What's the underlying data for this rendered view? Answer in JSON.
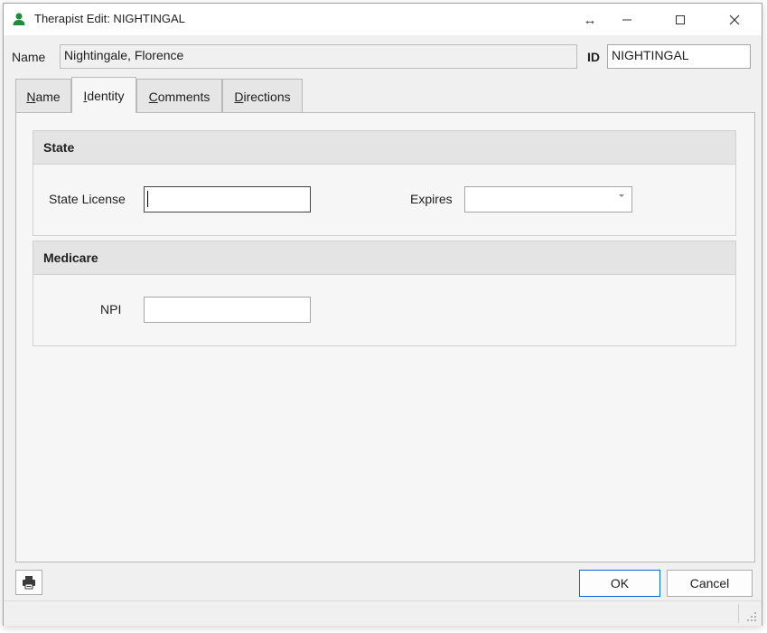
{
  "window": {
    "title": "Therapist Edit: NIGHTINGAL",
    "controls": {
      "resize": "↔",
      "minimize": "—",
      "maximize": "☐",
      "close": "✕"
    }
  },
  "header": {
    "name_label": "Name",
    "name_value": "Nightingale, Florence",
    "id_label": "ID",
    "id_value": "NIGHTINGAL"
  },
  "tabs": [
    {
      "accel": "N",
      "rest": "ame"
    },
    {
      "accel": "I",
      "rest": "dentity"
    },
    {
      "accel": "C",
      "rest": "omments"
    },
    {
      "accel": "D",
      "rest": "irections"
    }
  ],
  "active_tab": "Identity",
  "state_group": {
    "title": "State",
    "license_label": "State License",
    "license_value": "",
    "expires_label": "Expires",
    "expires_value": ""
  },
  "medicare_group": {
    "title": "Medicare",
    "npi_label": "NPI",
    "npi_value": ""
  },
  "footer": {
    "print_icon": "printer-icon",
    "ok_label": "OK",
    "cancel_label": "Cancel"
  },
  "colors": {
    "accent": "#0a64d6",
    "icon_green": "#1e8c3a",
    "group_header_bg": "#e4e4e4"
  }
}
